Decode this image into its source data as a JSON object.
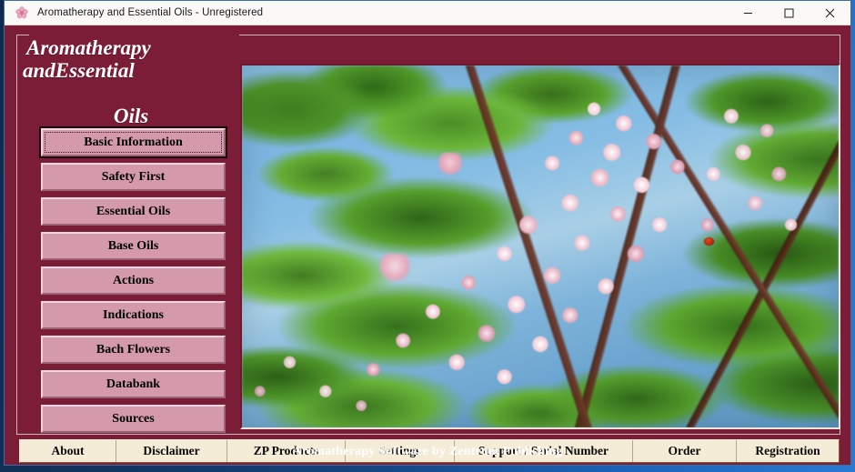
{
  "window": {
    "title": "Aromatherapy and Essential Oils - Unregistered",
    "icon": "flower-icon",
    "minimize_label": "–",
    "maximize_label": "□",
    "close_label": "✕"
  },
  "heading": {
    "line1": "Aromatherapy",
    "line2_left": "and",
    "line2_right": "Essential",
    "line3": "Oils"
  },
  "sidebar": {
    "items": [
      {
        "label": "Basic Information",
        "selected": true
      },
      {
        "label": "Safety First",
        "selected": false
      },
      {
        "label": "Essential Oils",
        "selected": false
      },
      {
        "label": "Base Oils",
        "selected": false
      },
      {
        "label": "Actions",
        "selected": false
      },
      {
        "label": "Indications",
        "selected": false
      },
      {
        "label": "Bach Flowers",
        "selected": false
      },
      {
        "label": "Databank",
        "selected": false
      },
      {
        "label": "Sources",
        "selected": false
      }
    ]
  },
  "photo": {
    "alt": "Close-up photograph of pale pink lilac blossoms with green leaves against a blue sky"
  },
  "toolbar": {
    "items": [
      {
        "label": "About"
      },
      {
        "label": "Disclaimer"
      },
      {
        "label": "ZP Products"
      },
      {
        "label": "Settings"
      },
      {
        "label": "Support / Serial Number"
      },
      {
        "label": "Order"
      },
      {
        "label": "Registration"
      }
    ]
  },
  "footer": {
    "text": "Aromatherapy Software by Zentrum Publishing"
  },
  "colors": {
    "burgundy": "#7b1d36",
    "button_pink": "#d49aab",
    "toolbar_cream": "#f5ecd8",
    "titlebar": "#faf9f8",
    "text_white": "#ffffff"
  }
}
